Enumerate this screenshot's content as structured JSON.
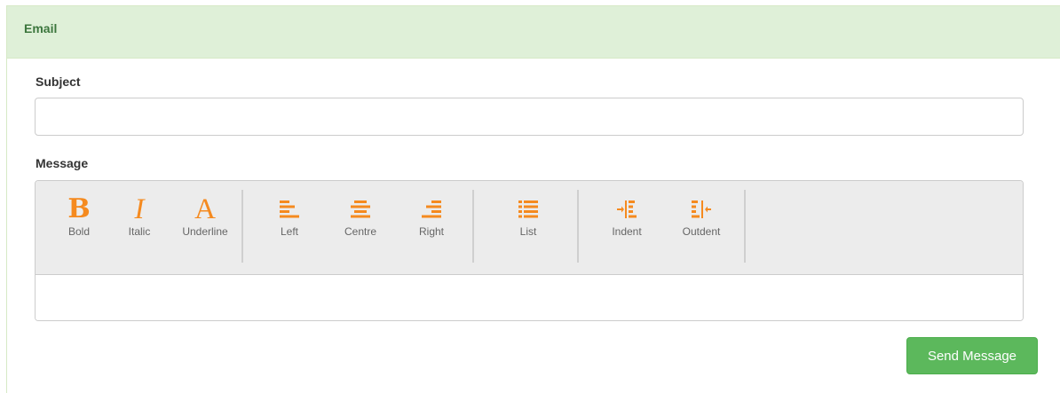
{
  "panel": {
    "title": "Email"
  },
  "subject": {
    "label": "Subject",
    "value": "",
    "placeholder": ""
  },
  "message": {
    "label": "Message",
    "value": ""
  },
  "toolbar": {
    "groups": [
      [
        {
          "label": "Bold",
          "icon": "bold-icon"
        },
        {
          "label": "Italic",
          "icon": "italic-icon"
        },
        {
          "label": "Underline",
          "icon": "underline-icon"
        }
      ],
      [
        {
          "label": "Left",
          "icon": "align-left-icon"
        },
        {
          "label": "Centre",
          "icon": "align-center-icon"
        },
        {
          "label": "Right",
          "icon": "align-right-icon"
        }
      ],
      [
        {
          "label": "List",
          "icon": "list-icon"
        }
      ],
      [
        {
          "label": "Indent",
          "icon": "indent-icon"
        },
        {
          "label": "Outdent",
          "icon": "outdent-icon"
        }
      ]
    ]
  },
  "actions": {
    "send_label": "Send Message"
  },
  "colors": {
    "panel_heading_bg": "#dff0d8",
    "panel_heading_text": "#3c763d",
    "icon_accent": "#f58a1f",
    "send_button": "#5cb85c"
  }
}
